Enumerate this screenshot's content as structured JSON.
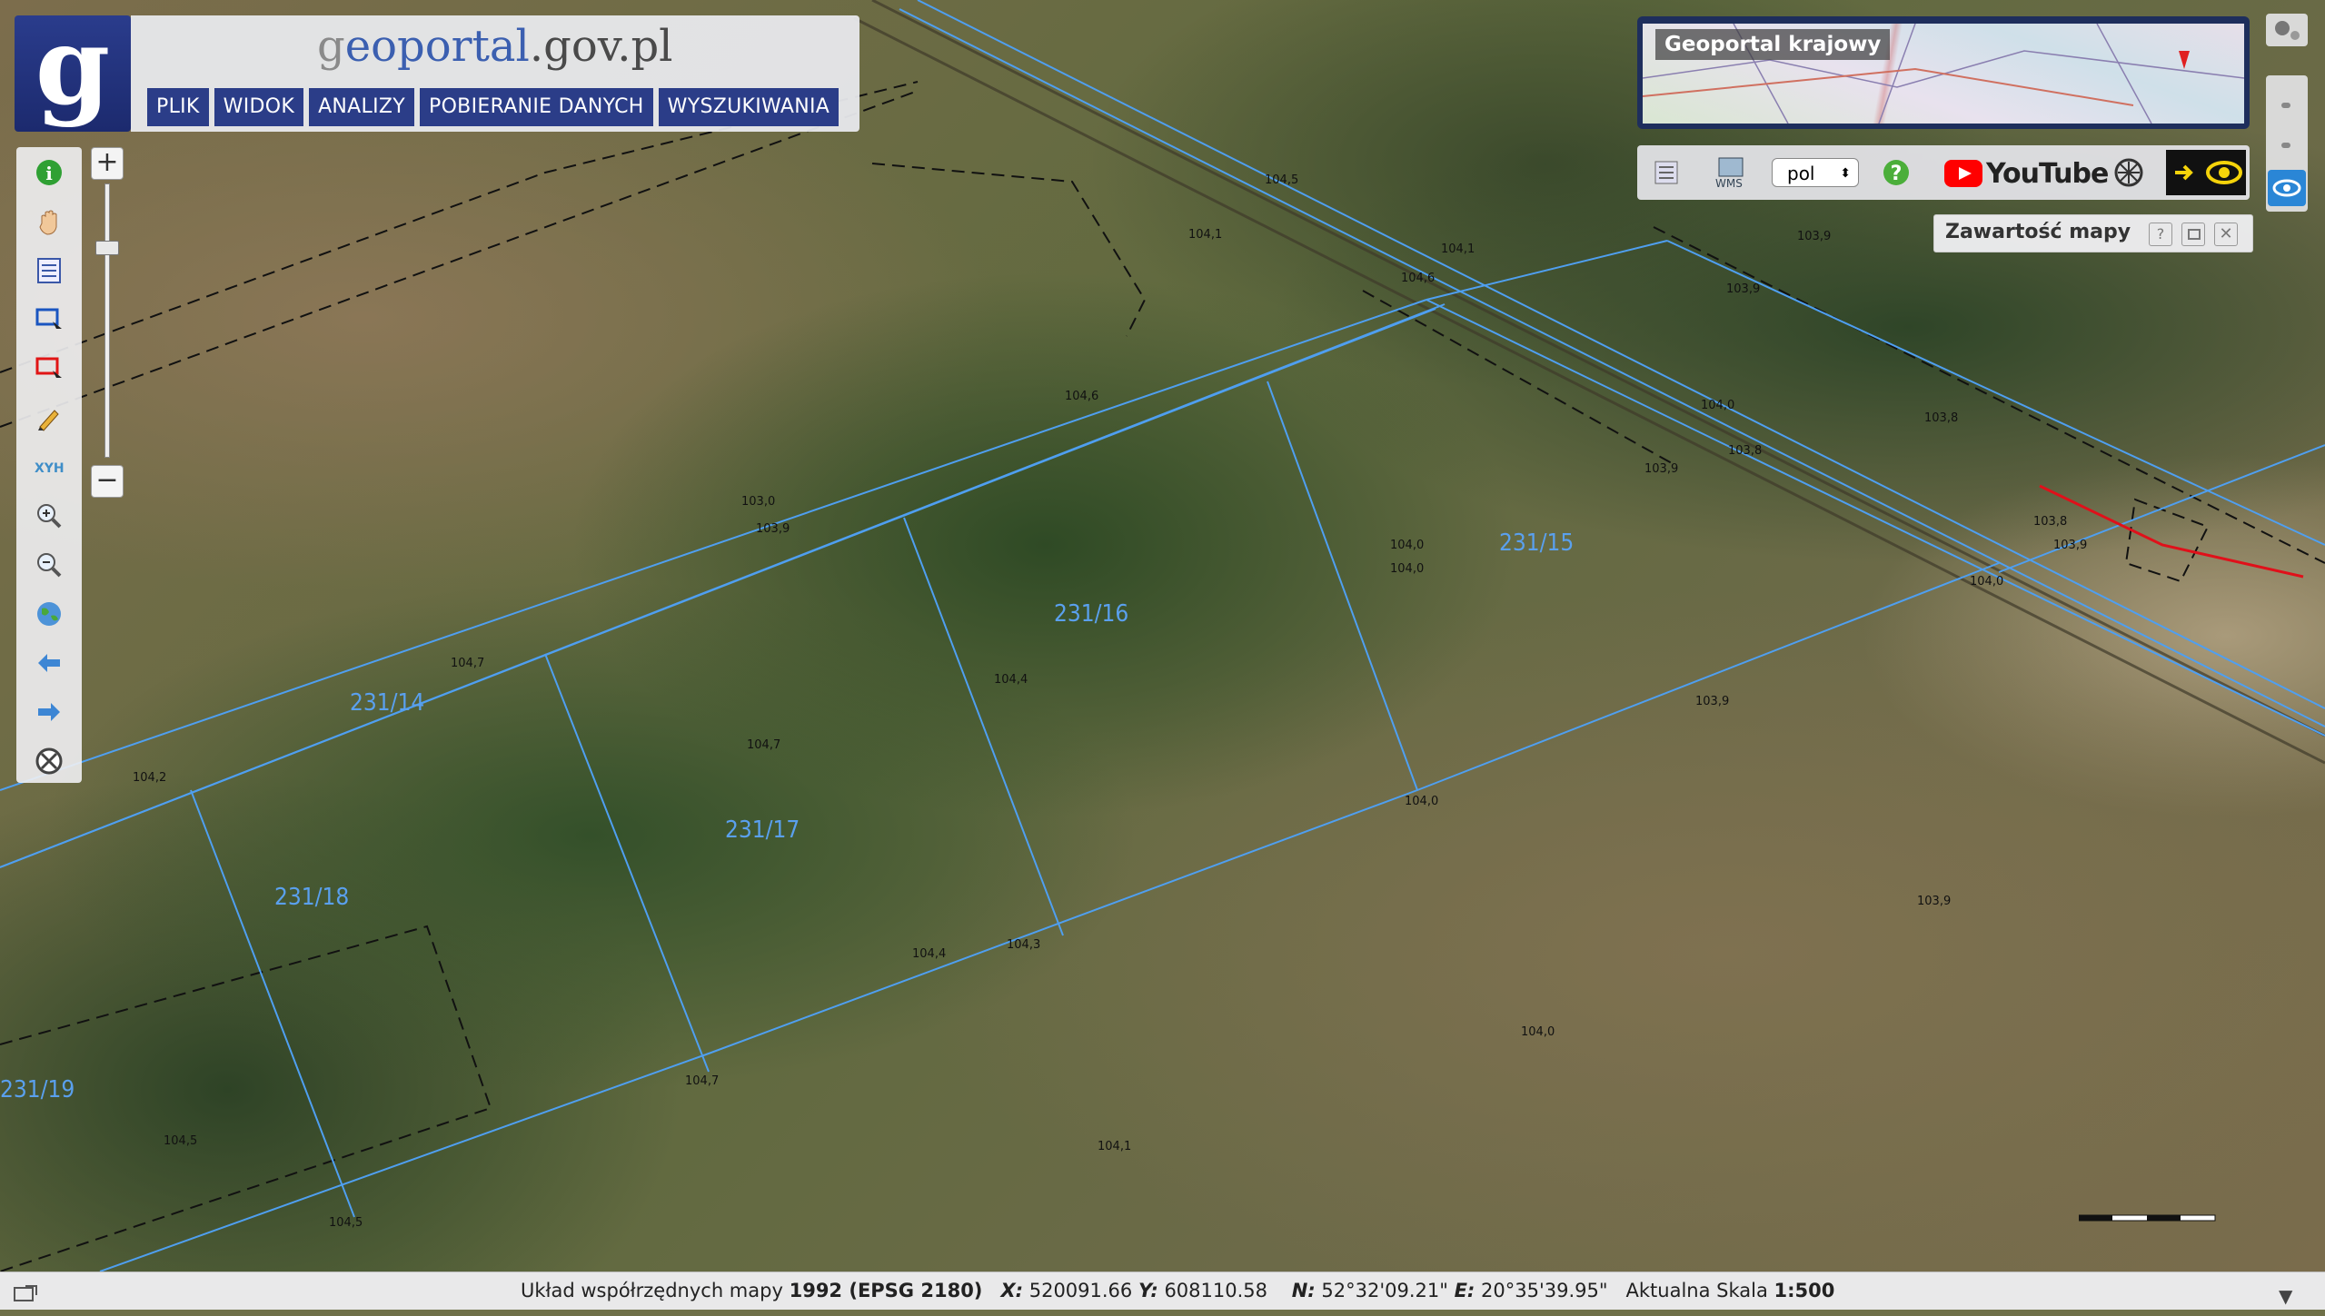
{
  "logo": {
    "letter": "g",
    "site": {
      "g": "g",
      "eoportal": "eoportal",
      "dot": ".",
      "gov": "gov",
      "pl": ".pl"
    }
  },
  "menu": [
    "PLIK",
    "WIDOK",
    "ANALIZY",
    "POBIERANIE DANYCH",
    "WYSZUKIWANIA"
  ],
  "overview": {
    "title": "Geoportal krajowy"
  },
  "toolbar_top": {
    "language": "pol",
    "youtube": "YouTube"
  },
  "content_panel": {
    "title": "Zawartość mapy"
  },
  "parcels": [
    "231/14",
    "231/15",
    "231/16",
    "231/17",
    "231/18",
    "231/19"
  ],
  "elevations": [
    "104,5",
    "104,1",
    "104,1",
    "103,9",
    "104,6",
    "103,9",
    "104,6",
    "103,8",
    "104,0",
    "103,9",
    "103,8",
    "103,9",
    "103,8",
    "104,0",
    "103,0",
    "104,0",
    "104,0",
    "103,9",
    "104,7",
    "104,4",
    "103,9",
    "104,2",
    "104,7",
    "104,4",
    "104,3",
    "104,0",
    "103,9",
    "104,7",
    "104,0",
    "104,5",
    "104,1",
    "104,5"
  ],
  "status": {
    "system_label": "Układ współrzędnych mapy",
    "system_value": "1992 (EPSG 2180)",
    "x_label": "X:",
    "x_value": "520091.66",
    "y_label": "Y:",
    "y_value": "608110.58",
    "n_label": "N:",
    "n_value": "52°32'09.21\"",
    "e_label": "E:",
    "e_value": "20°35'39.95\"",
    "scale_label": "Aktualna Skala",
    "scale_value": "1:500"
  },
  "colors": {
    "parcel_line": "#4f9ff0",
    "header_blue": "#2b3d88",
    "youtube_red": "#ff0000"
  },
  "icons": [
    "info-icon",
    "pan-hand-icon",
    "legend-icon",
    "select-rectangle-icon",
    "select-rectangle-red-icon",
    "pencil-icon",
    "xyh-icon",
    "zoom-in-icon",
    "zoom-out-icon",
    "globe-icon",
    "back-arrow-icon",
    "forward-arrow-icon",
    "close-circle-icon"
  ]
}
